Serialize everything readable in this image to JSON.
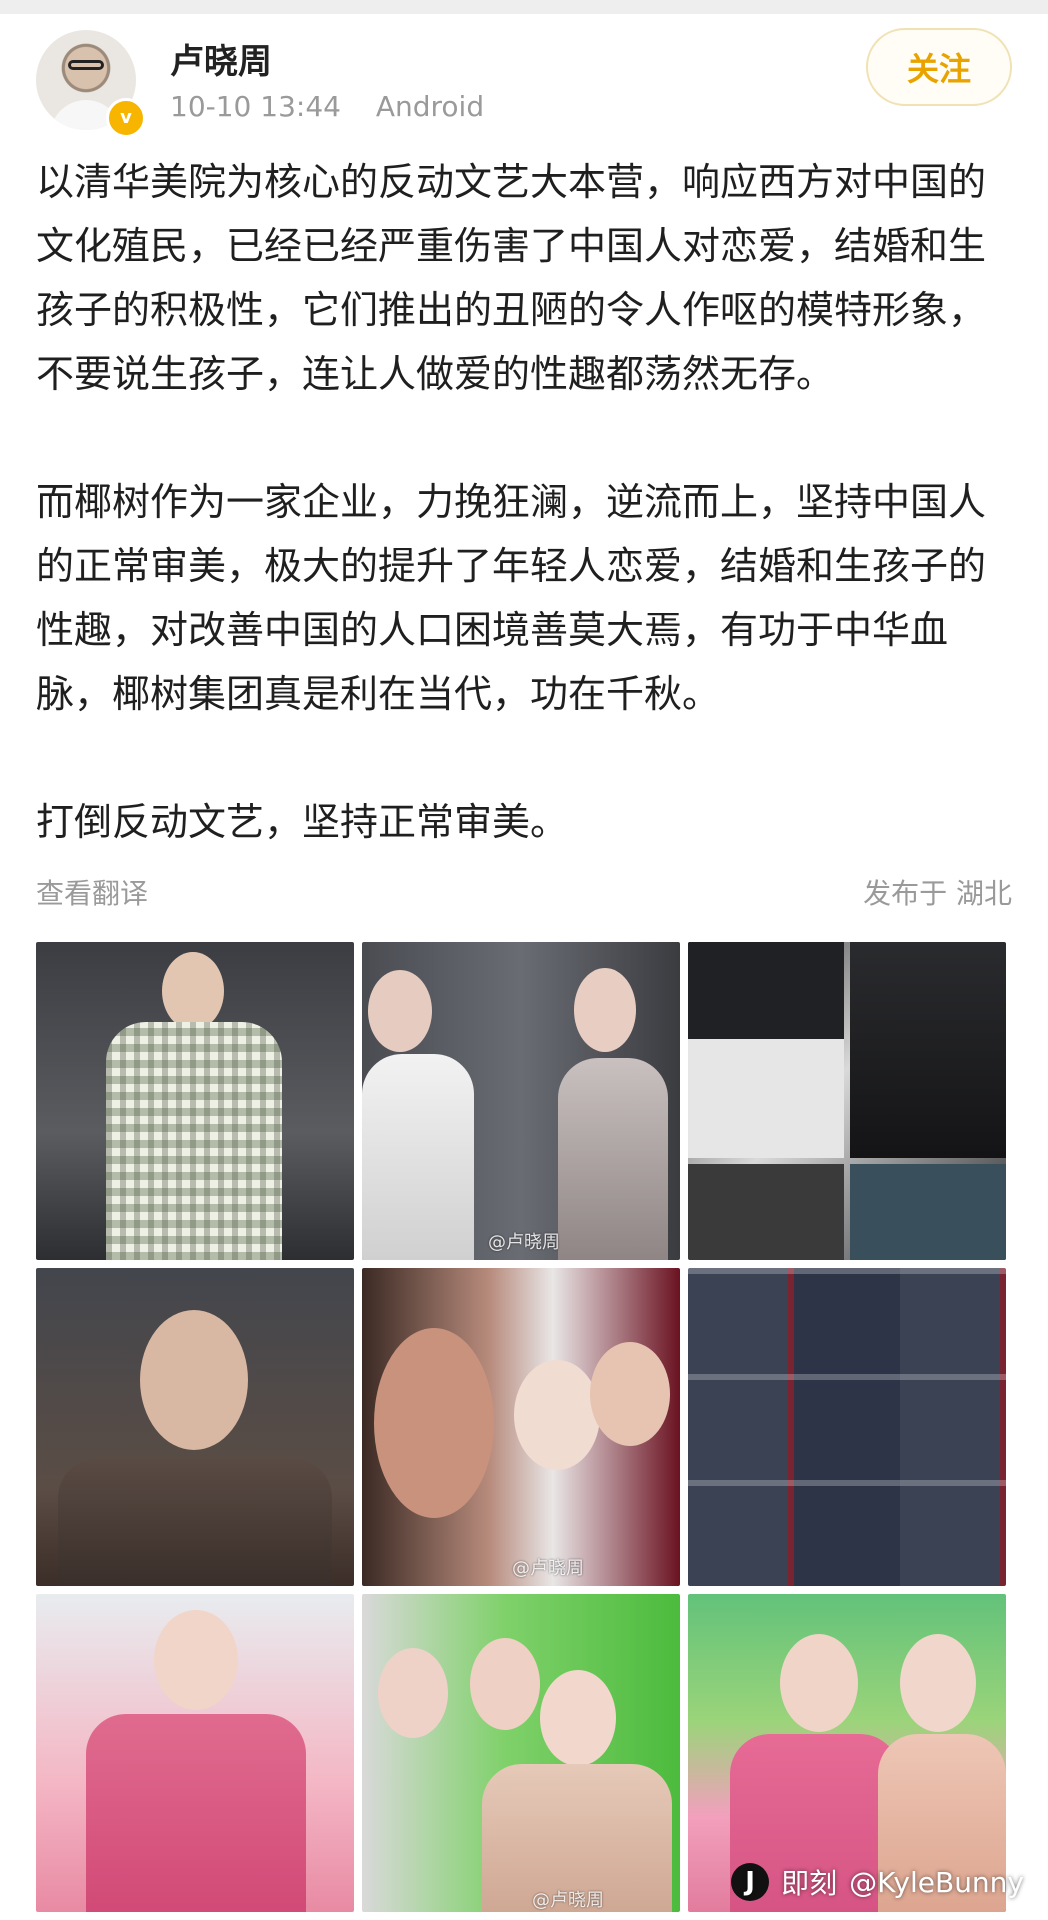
{
  "user": {
    "name": "卢晓周",
    "time": "10-10 13:44",
    "device": "Android",
    "follow_label": "关注"
  },
  "post": {
    "paragraphs": [
      "以清华美院为核心的反动文艺大本营，响应西方对中国的文化殖民，已经已经严重伤害了中国人对恋爱，结婚和生孩子的积极性，它们推出的丑陋的令人作呕的模特形象，不要说生孩子，连让人做爱的性趣都荡然无存。",
      "而椰树作为一家企业，力挽狂澜，逆流而上，坚持中国人的正常审美，极大的提升了年轻人恋爱，结婚和生孩子的性趣，对改善中国的人口困境善莫大焉，有功于中华血脉，椰树集团真是利在当代，功在千秋。",
      "打倒反动文艺，坚持正常审美。"
    ],
    "translate_label": "查看翻译",
    "location_label": "发布于 湖北"
  },
  "images": {
    "watermark_2": "@卢晓周",
    "watermark_5": "@卢晓周",
    "watermark_8": "@卢晓周"
  },
  "footer": {
    "brand": "即刻",
    "handle": "@KyleBunny"
  },
  "colors": {
    "accent": "#e9a300",
    "muted": "#9a9a9a"
  }
}
